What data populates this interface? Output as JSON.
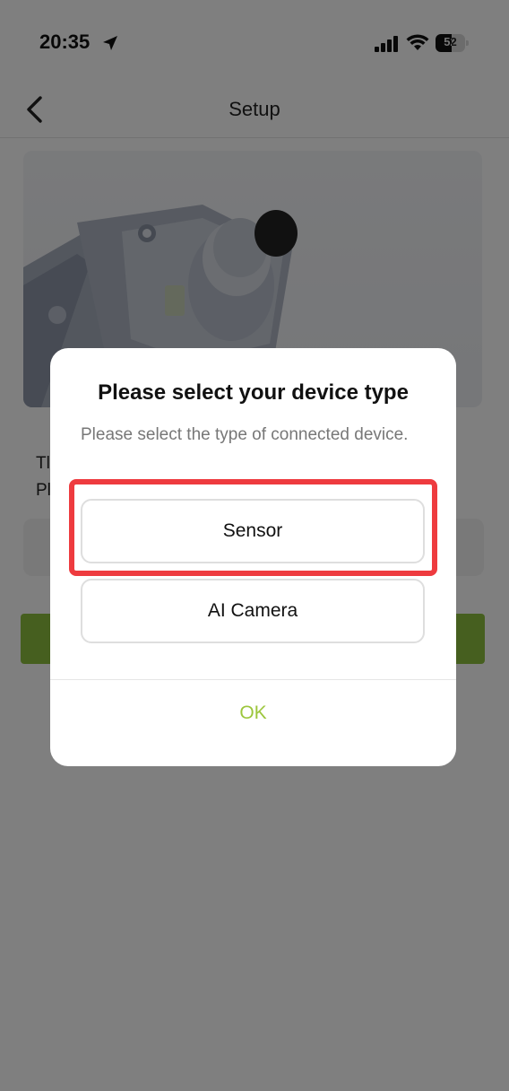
{
  "status_bar": {
    "time": "20:35",
    "battery_level": "52",
    "icons": [
      "location-arrow-icon",
      "cellular-signal-icon",
      "wifi-icon",
      "battery-icon"
    ]
  },
  "nav": {
    "title": "Setup",
    "back_icon": "chevron-left-icon"
  },
  "page": {
    "text_fragment_1": "Tl",
    "text_fragment_2": "Pl",
    "accent_color": "#8cbf3f"
  },
  "dialog": {
    "title": "Please select your device type",
    "message": "Please select the type of connected device.",
    "options": [
      {
        "label": "Sensor",
        "highlighted": true
      },
      {
        "label": "AI Camera",
        "highlighted": false
      }
    ],
    "confirm_label": "OK",
    "confirm_color": "#9cc63d",
    "highlight_color": "#ee3b3f"
  }
}
